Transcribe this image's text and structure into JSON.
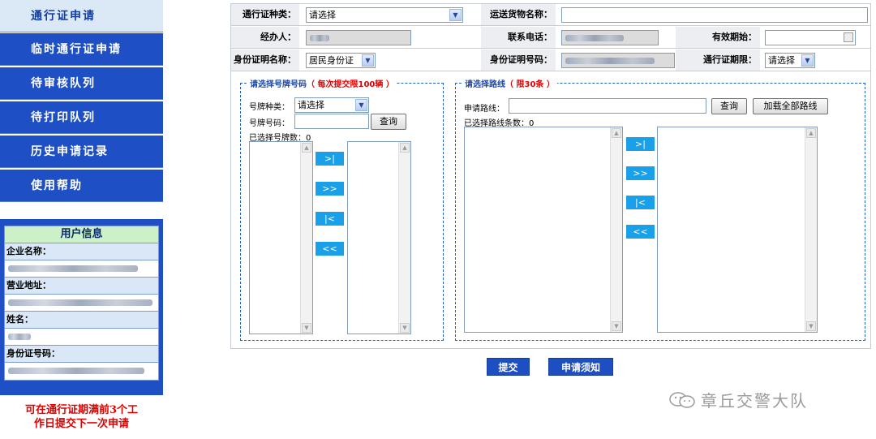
{
  "sidebar": {
    "items": [
      {
        "label": "通行证申请"
      },
      {
        "label": "临时通行证申请"
      },
      {
        "label": "待审核队列"
      },
      {
        "label": "待打印队列"
      },
      {
        "label": "历史申请记录"
      },
      {
        "label": "使用帮助"
      }
    ]
  },
  "user_info": {
    "title": "用户信息",
    "company_label": "企业名称：",
    "address_label": "营业地址：",
    "name_label": "姓名：",
    "id_label": "身份证号码："
  },
  "note": {
    "line1": "可在通行证期满前3个工",
    "line2": "作日提交下一次申请"
  },
  "form": {
    "pass_type_label": "通行证种类：",
    "pass_type_value": "请选择",
    "cargo_label": "运送货物名称：",
    "handler_label": "经办人：",
    "phone_label": "联系电话：",
    "valid_start_label": "有效期始：",
    "id_type_label": "身份证明名称：",
    "id_type_value": "居民身份证",
    "id_number_label": "身份证明号码：",
    "period_label": "通行证期限：",
    "period_value": "请选择"
  },
  "plates": {
    "legend": "请选择号牌号码",
    "limit": "（ 每次提交限100辆 ）",
    "type_label": "号牌种类：",
    "type_value": "请选择",
    "number_label": "号牌号码：",
    "query": "查询",
    "selected": "已选择号牌数：0",
    "b1": ">|",
    "b2": ">>",
    "b3": "|<",
    "b4": "<<"
  },
  "routes": {
    "legend": "请选择路线",
    "limit": "（ 限30条 ）",
    "route_label": "申请路线：",
    "query": "查询",
    "load_all": "加载全部路线",
    "selected": "已选择路线条数：0",
    "b1": ">|",
    "b2": ">>",
    "b3": "|<",
    "b4": "<<"
  },
  "actions": {
    "submit": "提交",
    "notice": "申请须知"
  },
  "watermark": {
    "text": "章丘交警大队"
  }
}
